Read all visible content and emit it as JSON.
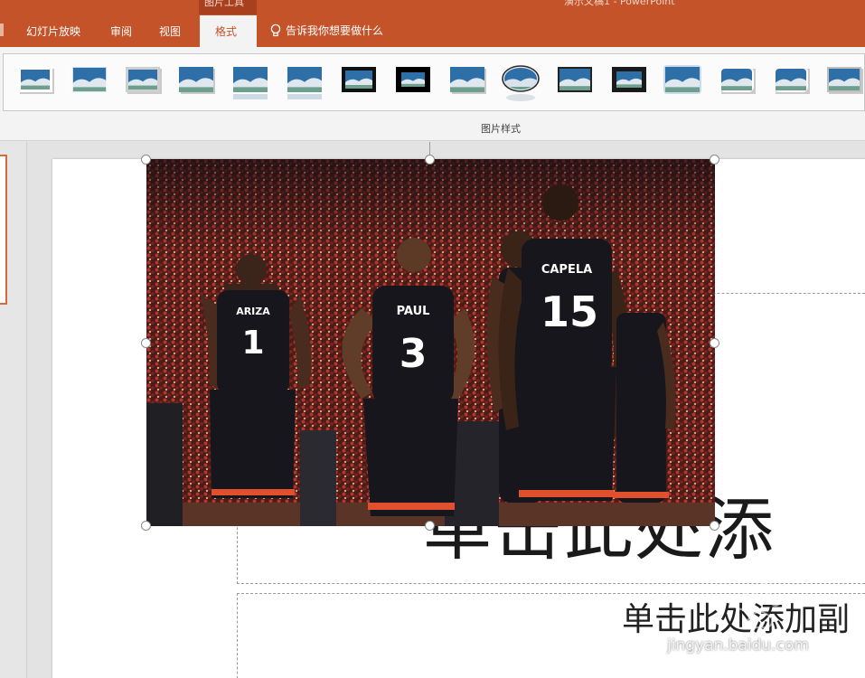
{
  "ribbon_tabs": {
    "slideshow": "幻灯片放映",
    "review": "审阅",
    "view": "视图",
    "format": "格式"
  },
  "contextual_tab_group": "图片工具",
  "document_title": "演示文稿1  -  PowerPoint",
  "tell_me": "告诉我你想要做什么",
  "picture_styles": {
    "group_label": "图片样式",
    "items": [
      "simple-frame-white",
      "soft-edge-rectangle",
      "simple-frame-black-shadow",
      "drop-shadow-rectangle",
      "reflected-rounded-rectangle",
      "soft-edge-reflection",
      "thick-black-frame",
      "thick-matte-black",
      "center-shadow-rectangle",
      "oval-reflection",
      "double-frame-black",
      "thick-frame-black",
      "soft-glow-rectangle",
      "rounded-diagonal-corner",
      "snip-diagonal-corner",
      "metal-frame"
    ]
  },
  "slide": {
    "title_placeholder": "单击此处添",
    "subtitle_placeholder": "单击此处添加副",
    "picture": {
      "description": "Houston Rockets players viewed from behind",
      "jerseys": [
        {
          "name": "ARIZA",
          "number": "1"
        },
        {
          "name": "PAUL",
          "number": "3"
        },
        {
          "name": "CAPELA",
          "number": "15"
        }
      ]
    }
  },
  "watermark": "jingyan.baidu.com",
  "colors": {
    "accent": "#c4532a",
    "ribbon": "#f3f3f3",
    "slide_bg": "#ffffff",
    "jersey": "#16161c",
    "jersey_trim": "#e0502c"
  }
}
